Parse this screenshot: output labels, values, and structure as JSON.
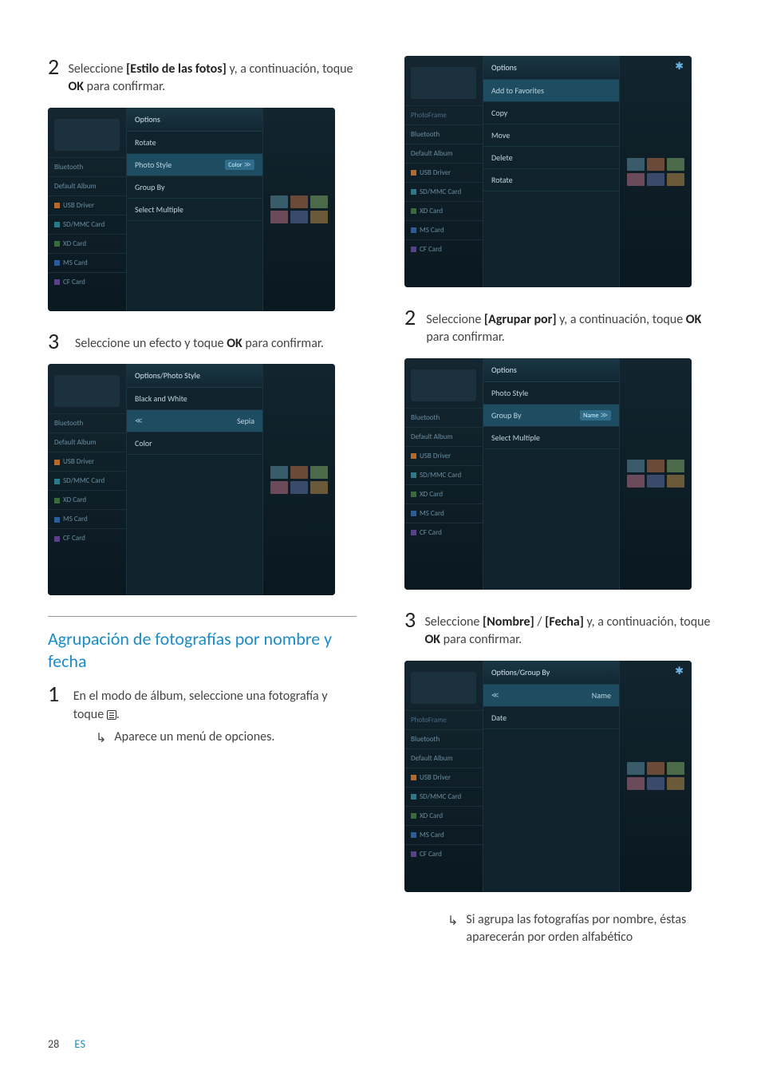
{
  "left": {
    "step2": {
      "pre": "Seleccione ",
      "bold": "[Estilo de las fotos]",
      "post1": " y, a continuación, toque ",
      "ok": "OK",
      "post2": " para confirmar."
    },
    "step3": {
      "pre": "Seleccione un efecto y toque ",
      "ok": "OK",
      "post": " para confirmar."
    },
    "section_title": "Agrupación de fotografías por nombre y fecha",
    "step1": {
      "text1": "En el modo de álbum, seleccione una fotografía y toque ",
      "text2": "."
    },
    "step1_arrow": "Aparece un menú de opciones."
  },
  "right": {
    "step2": {
      "pre": "Seleccione ",
      "bold": "[Agrupar por]",
      "post1": " y, a continuación, toque ",
      "ok": "OK",
      "post2": " para confirmar."
    },
    "step3": {
      "pre": "Seleccione ",
      "bold1": "[Nombre]",
      "sep": " / ",
      "bold2": "[Fecha]",
      "post1": " y, a continuación, toque ",
      "ok": "OK",
      "post2": " para confirmar."
    },
    "final_arrow": "Si agrupa las fotografías por nombre, éstas aparecerán por orden alfabético"
  },
  "nav": {
    "photoframe": "PhotoFrame",
    "bluetooth": "Bluetooth",
    "default_album": "Default Album",
    "usb": "USB Driver",
    "sdmmc": "SD/MMC Card",
    "xd": "XD Card",
    "ms": "MS Card",
    "cf": "CF Card"
  },
  "sc1": {
    "hdr": "Options",
    "rotate": "Rotate",
    "photo_style": "Photo Style",
    "photo_style_badge": "Color",
    "group_by": "Group By",
    "select_multiple": "Select Multiple"
  },
  "sc2": {
    "hdr": "Options/Photo Style",
    "bw": "Black and White",
    "sepia": "Sepia",
    "color": "Color"
  },
  "sc3": {
    "hdr": "Options",
    "add_fav": "Add to Favorites",
    "copy": "Copy",
    "move": "Move",
    "delete": "Delete",
    "rotate": "Rotate"
  },
  "sc4": {
    "hdr": "Options",
    "photo_style": "Photo Style",
    "group_by": "Group By",
    "group_by_badge": "Name",
    "select_multiple": "Select Multiple"
  },
  "sc5": {
    "hdr": "Options/Group By",
    "name": "Name",
    "date": "Date"
  },
  "footer": {
    "page": "28",
    "lang": "ES"
  }
}
